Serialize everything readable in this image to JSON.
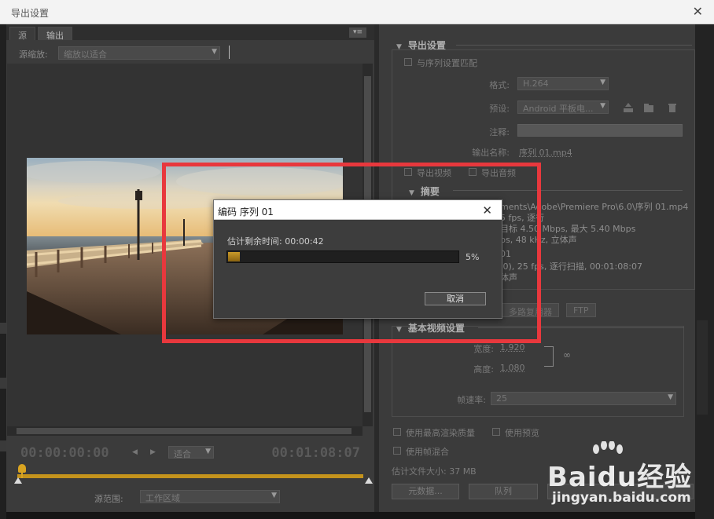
{
  "window": {
    "title": "导出设置",
    "close_glyph": "✕"
  },
  "left": {
    "tabs": [
      {
        "label": "源"
      },
      {
        "label": "输出"
      }
    ],
    "panel_menu_glyph": "▾≡",
    "source_scale": {
      "label": "源缩放:",
      "value": "缩放以适合"
    },
    "timecode_current": "00:00:00:00",
    "timecode_total": "00:01:08:07",
    "fit": {
      "value": "适合"
    },
    "source_range": {
      "label": "源范围:",
      "value": "工作区域"
    }
  },
  "export_settings": {
    "title": "导出设置",
    "match_sequence": "与序列设置匹配",
    "format": {
      "label": "格式:",
      "value": "H.264"
    },
    "preset": {
      "label": "预设:",
      "value": "Android 平板电..."
    },
    "comment": {
      "label": "注释:"
    },
    "output_name": {
      "label": "输出名称:",
      "value": "序列 01.mp4"
    },
    "export_video": "导出视频",
    "export_audio": "导出音频",
    "summary": {
      "title": "摘要",
      "lines": [
        "ments\\Adobe\\Premiere Pro\\6.0\\序列 01.mp4",
        "5 fps, 逐行",
        "目标 4.50 Mbps, 最大 5.40 Mbps",
        "ps, 48 kHz, 立体声",
        "01",
        ".0), 25 fps, 逐行扫描, 00:01:08:07",
        "体声"
      ]
    }
  },
  "right_tabs": [
    {
      "label": "多路复用器"
    },
    {
      "label": "FTP"
    }
  ],
  "basic_video": {
    "title": "基本视频设置",
    "width": {
      "label": "宽度:",
      "value": "1,920"
    },
    "height": {
      "label": "高度:",
      "value": "1,080"
    },
    "frame_rate": {
      "label": "帧速率:",
      "value": "25"
    }
  },
  "options": {
    "max_render_quality": "使用最高渲染质量",
    "use_preview": "使用预览",
    "use_frame_blending": "使用帧混合"
  },
  "estimated_size": "估计文件大小: 37 MB",
  "buttons": {
    "metadata": "元数据...",
    "queue": "队列"
  },
  "dialog": {
    "title": "编码 序列 01",
    "close_glyph": "✕",
    "eta_label": "估计剩余时间:",
    "eta_value": "00:00:42",
    "progress_percent": 5,
    "progress_label": "5%",
    "cancel": "取消"
  },
  "watermark": {
    "brand_a": "Bai",
    "brand_b": "du",
    "brand_c": "经验",
    "url": "jingyan.baidu.com"
  },
  "colors": {
    "accent": "#c4931c",
    "highlight": "#e8383d",
    "panel": "#3b3b3b"
  }
}
